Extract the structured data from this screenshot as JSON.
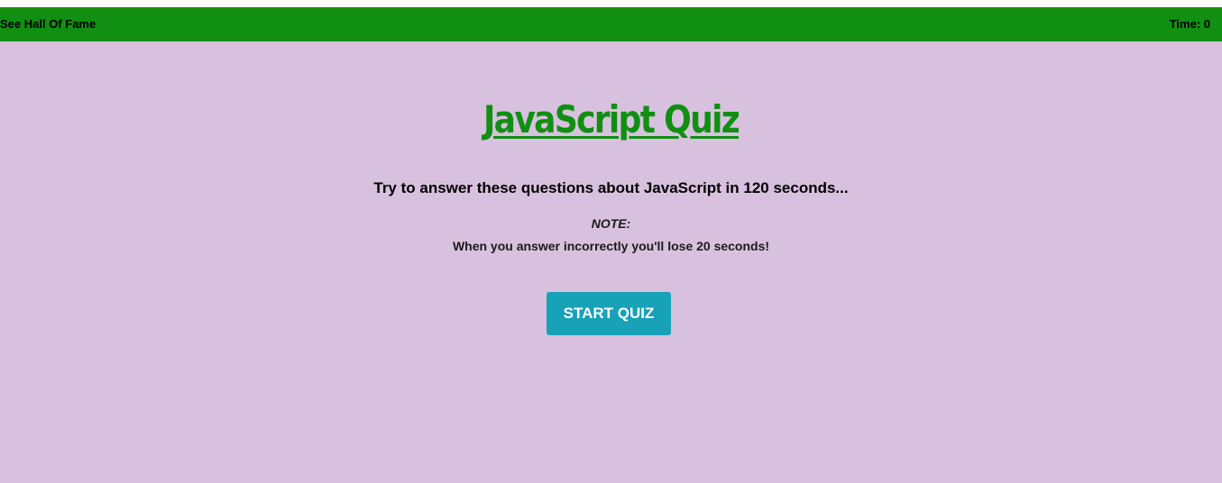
{
  "header": {
    "hall_of_fame_label": "See Hall Of Fame",
    "timer_label": "Time: 0"
  },
  "main": {
    "title": "JavaScript Quiz",
    "subtitle": "Try to answer these questions about JavaScript in 120 seconds...",
    "note_label": "NOTE:",
    "note_text": "When you answer incorrectly you'll lose 20 seconds!",
    "start_button_label": "START QUIZ"
  },
  "colors": {
    "header_bg": "#108f12",
    "page_bg": "#d8c1de",
    "title_color": "#108f12",
    "button_bg": "#17a2b8",
    "button_text": "#ffffff"
  }
}
